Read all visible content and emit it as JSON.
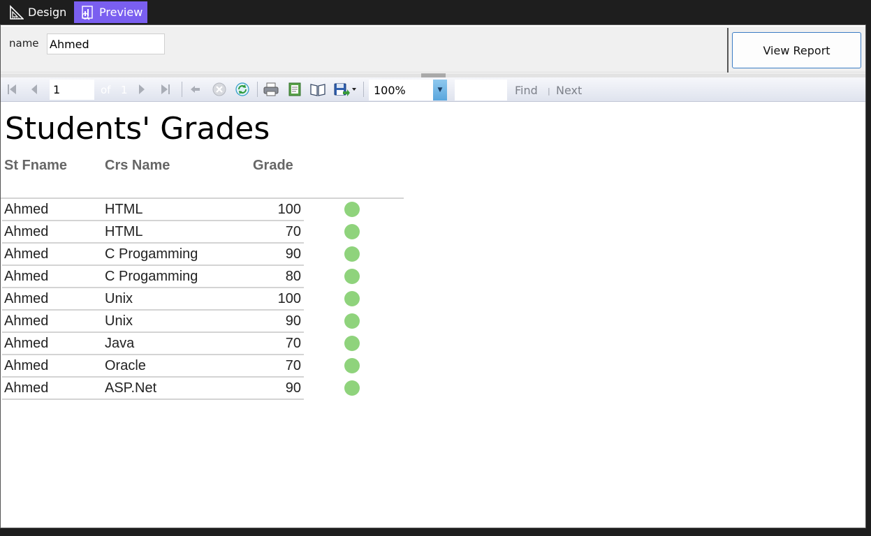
{
  "tabs": [
    {
      "label": "Design",
      "icon": "ruler-triangle-icon"
    },
    {
      "label": "Preview",
      "icon": "report-preview-icon"
    }
  ],
  "parameters": {
    "name_label": "name",
    "name_value": "Ahmed",
    "view_report_label": "View Report"
  },
  "toolbar": {
    "page_value": "1",
    "of_label": "of",
    "total_pages": "1",
    "zoom": "100%",
    "find_label": "Find",
    "find_separator": "|",
    "next_label": "Next"
  },
  "report": {
    "title": "Students' Grades",
    "columns": [
      "St Fname",
      "Crs Name",
      "Grade"
    ],
    "rows": [
      {
        "fname": "Ahmed",
        "course": "HTML",
        "grade": "100"
      },
      {
        "fname": "Ahmed",
        "course": "HTML",
        "grade": "70"
      },
      {
        "fname": "Ahmed",
        "course": "C Progamming",
        "grade": "90"
      },
      {
        "fname": "Ahmed",
        "course": "C Progamming",
        "grade": "80"
      },
      {
        "fname": "Ahmed",
        "course": "Unix",
        "grade": "100"
      },
      {
        "fname": "Ahmed",
        "course": "Unix",
        "grade": "90"
      },
      {
        "fname": "Ahmed",
        "course": "Java",
        "grade": "70"
      },
      {
        "fname": "Ahmed",
        "course": "Oracle",
        "grade": "70"
      },
      {
        "fname": "Ahmed",
        "course": "ASP.Net",
        "grade": "90"
      }
    ],
    "indicator_color": "#8fd37c"
  },
  "colors": {
    "preview_tab": "#7a5ff0",
    "view_report_border": "#3b7cc4"
  }
}
